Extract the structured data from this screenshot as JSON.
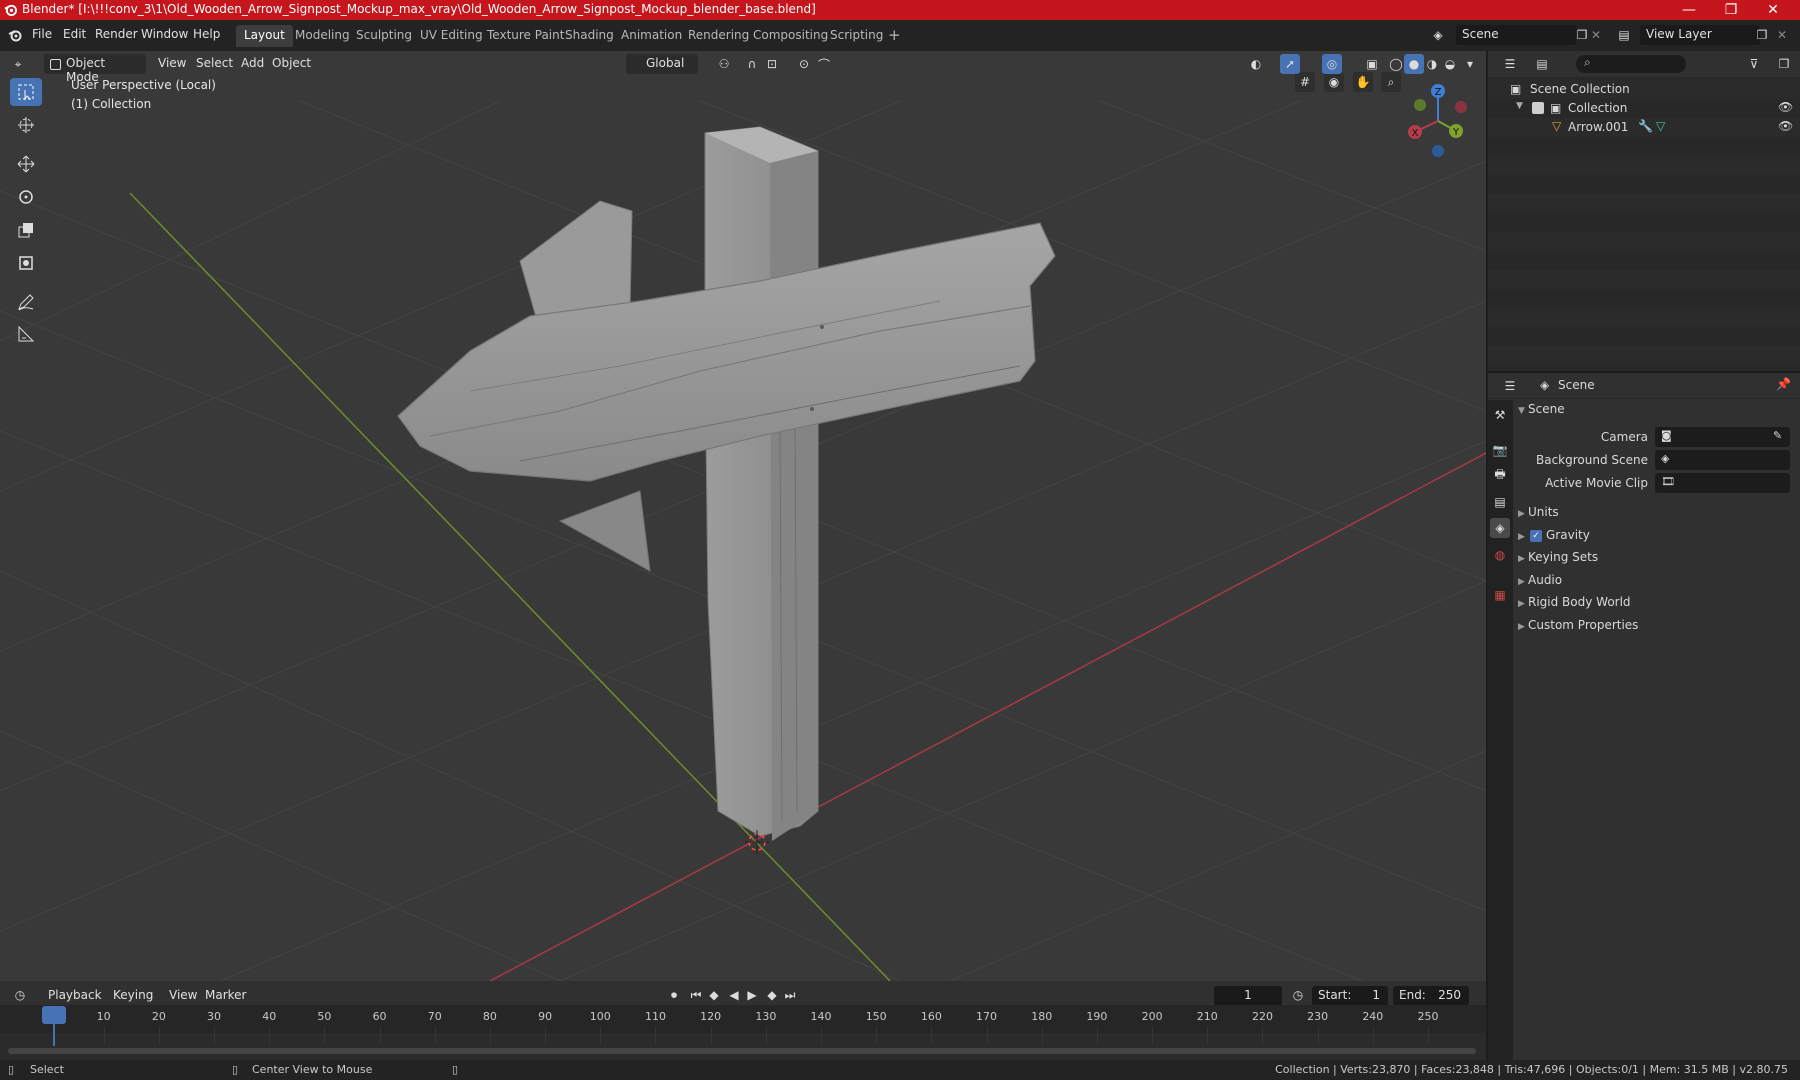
{
  "window": {
    "title": "Blender* [I:\\!!!conv_3\\1\\Old_Wooden_Arrow_Signpost_Mockup_max_vray\\Old_Wooden_Arrow_Signpost_Mockup_blender_base.blend]",
    "min": "—",
    "max": "❐",
    "close": "✕"
  },
  "menu": [
    "File",
    "Edit",
    "Render",
    "Window",
    "Help"
  ],
  "workspaces": [
    "Layout",
    "Modeling",
    "Sculpting",
    "UV Editing",
    "Texture Paint",
    "Shading",
    "Animation",
    "Rendering",
    "Compositing",
    "Scripting"
  ],
  "active_workspace": "Layout",
  "add_workspace": "+",
  "scene_field": "Scene",
  "view_layer_field": "View Layer",
  "viewport_header": {
    "mode": "Object Mode",
    "menus": [
      "View",
      "Select",
      "Add",
      "Object"
    ],
    "transform_orientation": "Global"
  },
  "viewport_overlay": {
    "perspective": "User Perspective (Local)",
    "collection": "(1) Collection"
  },
  "gizmo": {
    "z": "Z",
    "y": "Y",
    "x": "X"
  },
  "outliner": {
    "scene_collection": "Scene Collection",
    "collection": "Collection",
    "object": "Arrow.001"
  },
  "properties": {
    "context": "Scene",
    "panel_title": "Scene",
    "camera_label": "Camera",
    "background_label": "Background Scene",
    "movieclip_label": "Active Movie Clip",
    "subpanels": [
      "Units",
      "Gravity",
      "Keying Sets",
      "Audio",
      "Rigid Body World",
      "Custom Properties"
    ],
    "gravity_checked": true
  },
  "timeline": {
    "menus": [
      "Playback",
      "Keying",
      "View",
      "Marker"
    ],
    "current_frame": "1",
    "start_label": "Start:",
    "start_value": "1",
    "end_label": "End:",
    "end_value": "250",
    "ticks": [
      "1",
      "10",
      "20",
      "30",
      "40",
      "50",
      "60",
      "70",
      "80",
      "90",
      "100",
      "110",
      "120",
      "130",
      "140",
      "150",
      "160",
      "170",
      "180",
      "190",
      "200",
      "210",
      "220",
      "230",
      "240",
      "250"
    ]
  },
  "statusbar": {
    "select": "Select",
    "center_view": "Center View to Mouse",
    "stats": "Collection | Verts:23,870 | Faces:23,848 | Tris:47,696 | Objects:0/1 | Mem: 31.5 MB | v2.80.75"
  },
  "colors": {
    "title_red": "#c4161c",
    "accent_blue": "#4772b3",
    "x_axis": "#b83b4c",
    "y_axis": "#7fa22f",
    "z_axis": "#3f7fd8"
  }
}
